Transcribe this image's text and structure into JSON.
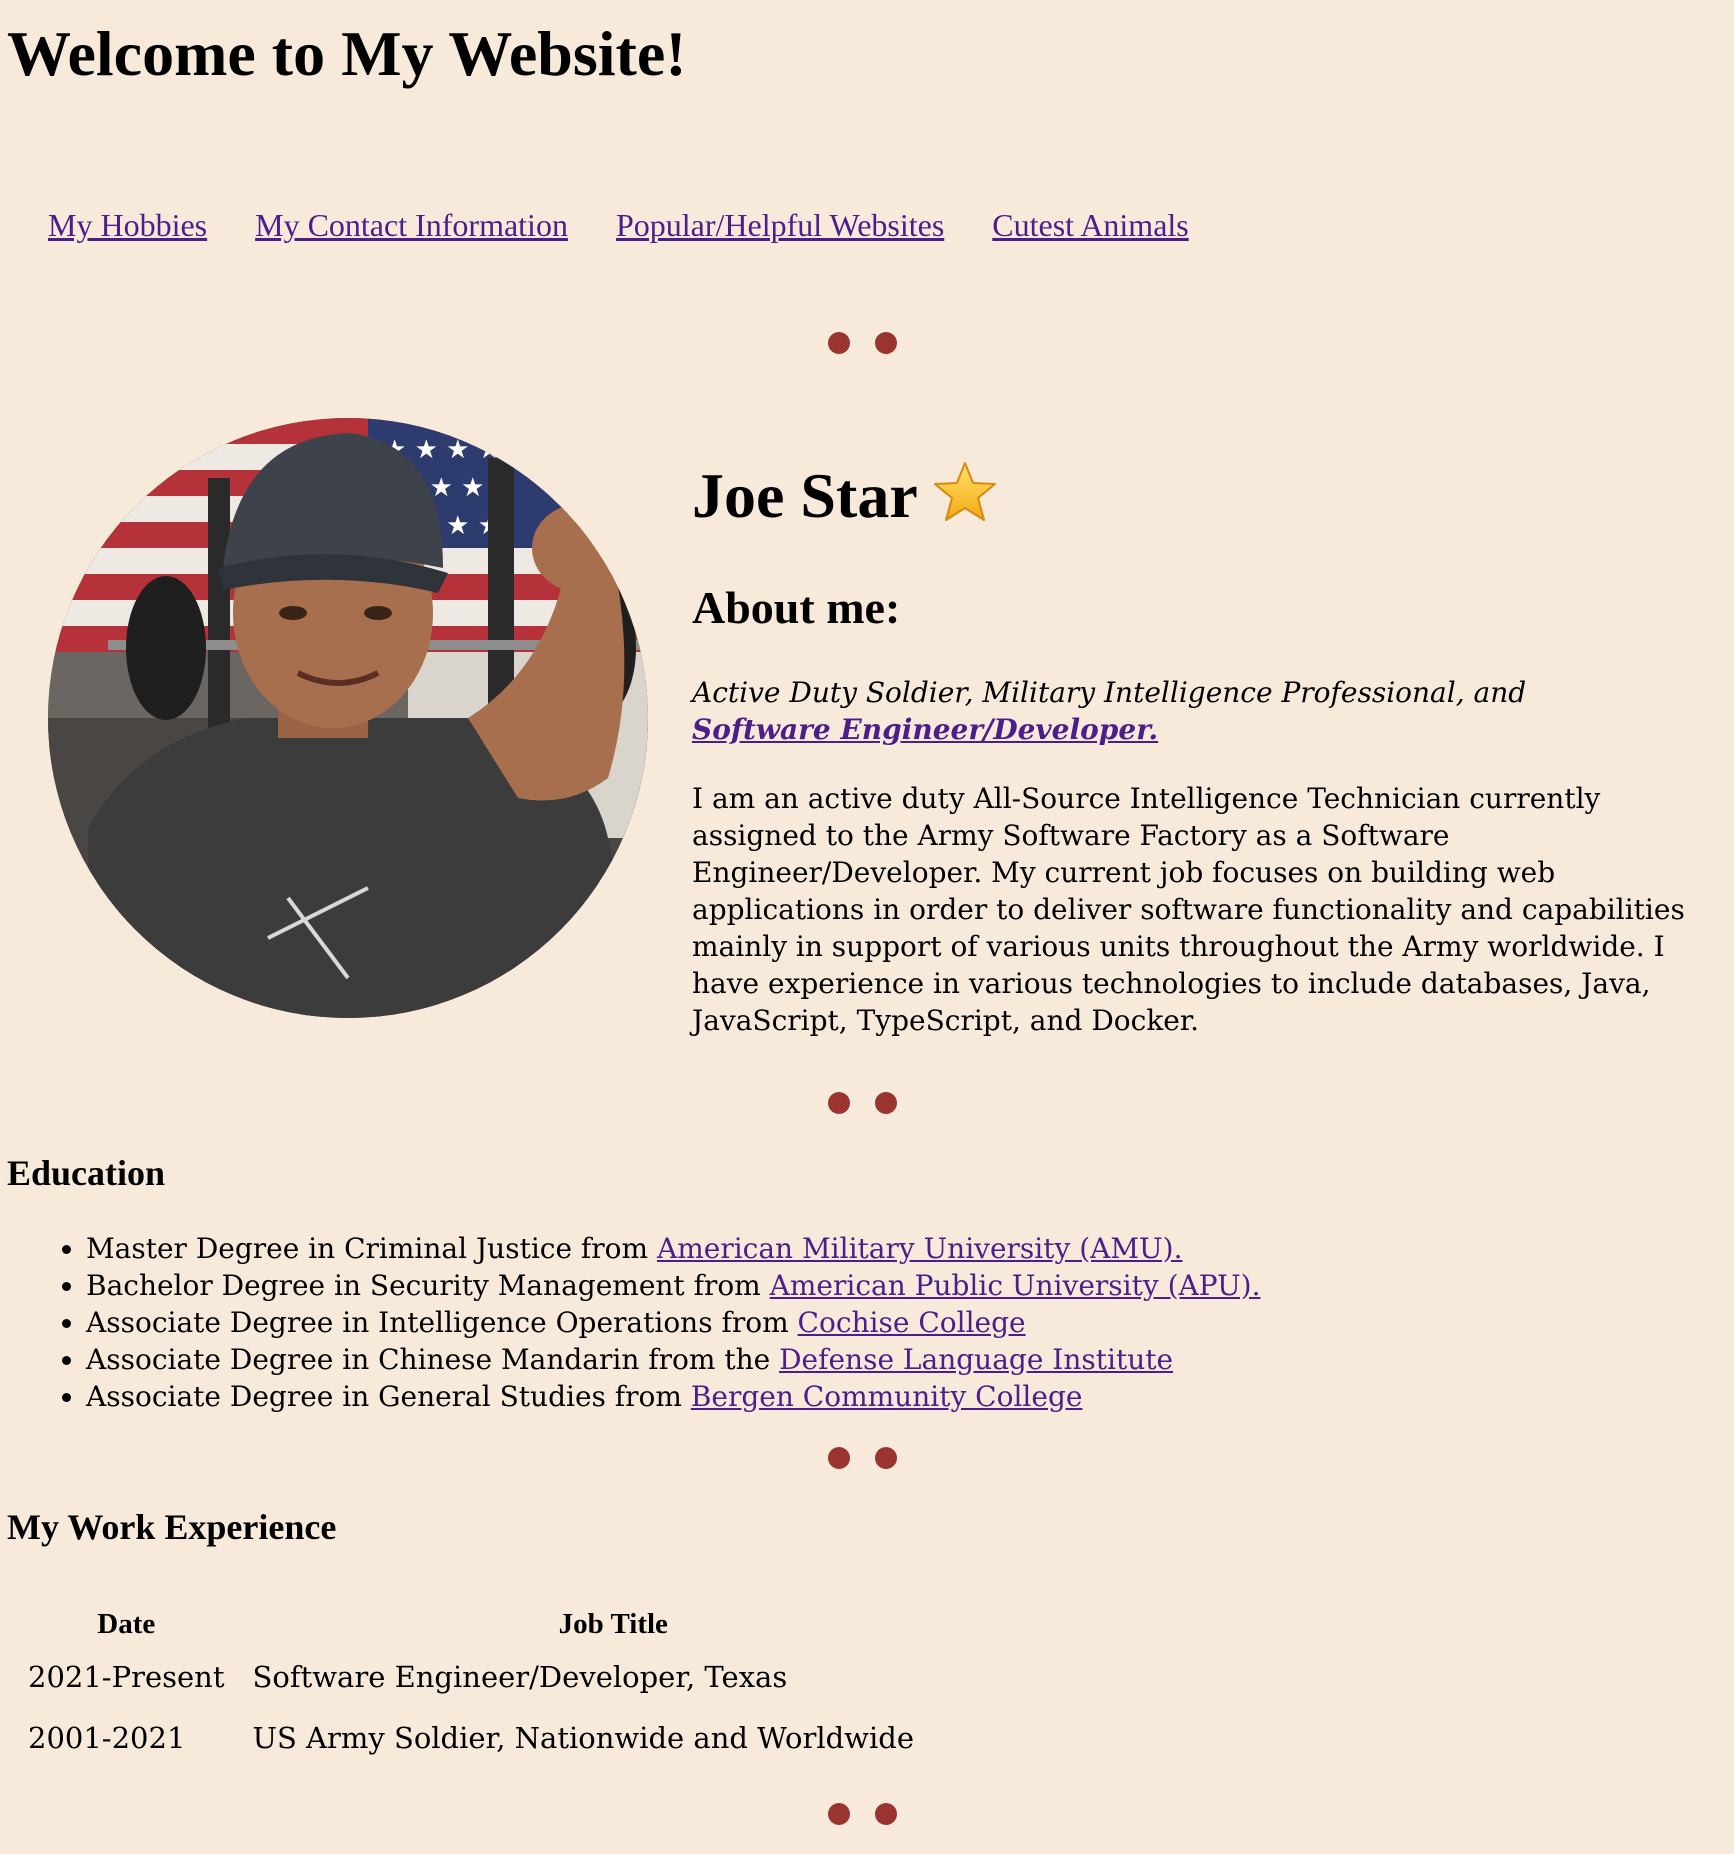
{
  "header": {
    "title": "Welcome to My Website!"
  },
  "nav": {
    "links": [
      {
        "label": "My Hobbies"
      },
      {
        "label": "My Contact Information"
      },
      {
        "label": "Popular/Helpful Websites"
      },
      {
        "label": "Cutest Animals"
      }
    ]
  },
  "profile": {
    "name": "Joe Star",
    "name_icon": "star-icon",
    "photo_icon": "profile-photo",
    "about_heading": "About me:",
    "tagline_text": "Active Duty Soldier, Military Intelligence Professional, and ",
    "tagline_link": "Software Engineer/Developer.",
    "about_body": "I am an active duty All-Source Intelligence Technician currently assigned to the Army Software Factory as a Software Engineer/Developer. My current job focuses on building web applications in order to deliver software functionality and capabilities mainly in support of various units throughout the Army worldwide. I have experience in various technologies to include databases, Java, JavaScript, TypeScript, and Docker."
  },
  "education": {
    "heading": "Education",
    "items": [
      {
        "text": "Master Degree in Criminal Justice from ",
        "link": "American Military University (AMU)."
      },
      {
        "text": "Bachelor Degree in Security Management from ",
        "link": "American Public University (APU)."
      },
      {
        "text": "Associate Degree in Intelligence Operations from ",
        "link": "Cochise College"
      },
      {
        "text": "Associate Degree in Chinese Mandarin from the ",
        "link": "Defense Language Institute"
      },
      {
        "text": "Associate Degree in General Studies from ",
        "link": "Bergen Community College"
      }
    ]
  },
  "work": {
    "heading": "My Work Experience",
    "columns": [
      "Date",
      "Job Title"
    ],
    "rows": [
      {
        "date": "2021-Present",
        "title": "Software Engineer/Developer, Texas"
      },
      {
        "date": "2001-2021",
        "title": "US Army Soldier, Nationwide and Worldwide"
      }
    ]
  },
  "colors": {
    "background": "#f7eadb",
    "link": "#4b1e8c",
    "divider_dot": "#9a3431"
  }
}
